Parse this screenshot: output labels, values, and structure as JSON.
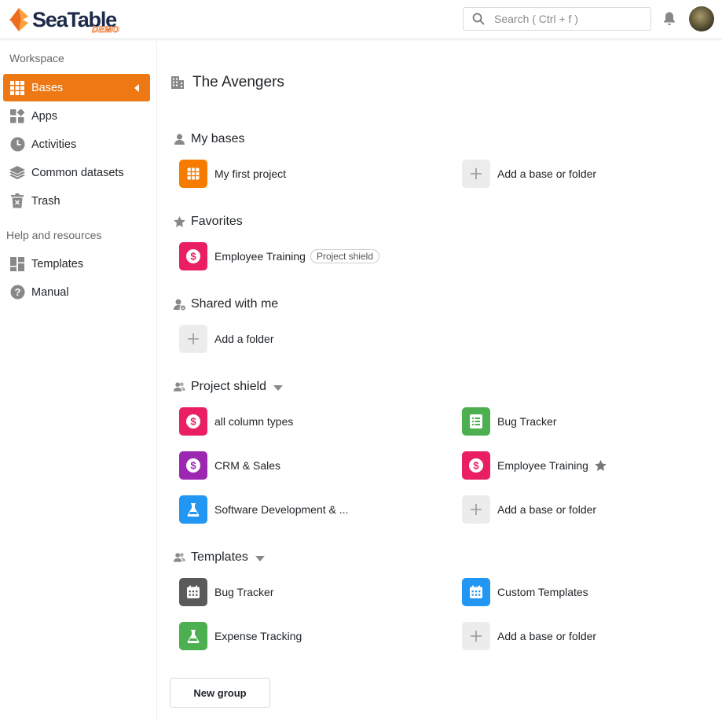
{
  "app": {
    "logo_text": "SeaTable",
    "logo_badge": "DEMO"
  },
  "search": {
    "placeholder": "Search ( Ctrl + f )"
  },
  "sidebar": {
    "workspace_header": "Workspace",
    "items": [
      {
        "label": "Bases",
        "icon": "grid-icon",
        "active": true
      },
      {
        "label": "Apps",
        "icon": "apps-icon"
      },
      {
        "label": "Activities",
        "icon": "clock-icon"
      },
      {
        "label": "Common datasets",
        "icon": "layers-icon"
      },
      {
        "label": "Trash",
        "icon": "trash-icon"
      }
    ],
    "help_header": "Help and resources",
    "help_items": [
      {
        "label": "Templates",
        "icon": "templates-icon"
      },
      {
        "label": "Manual",
        "icon": "question-icon"
      }
    ]
  },
  "main": {
    "workspace_title": "The Avengers",
    "sections": {
      "my_bases": {
        "title": "My bases",
        "tiles": [
          "My first project",
          "Add a base or folder"
        ]
      },
      "favorites": {
        "title": "Favorites",
        "tiles": [
          "Employee Training"
        ],
        "badge": "Project shield"
      },
      "shared": {
        "title": "Shared with me",
        "tiles": [
          "Add a folder"
        ]
      },
      "project_shield": {
        "title": "Project shield",
        "tiles": [
          "all column types",
          "Bug Tracker",
          "CRM & Sales",
          "Employee Training",
          "Software Development & ...",
          "Add a base or folder"
        ]
      },
      "templates": {
        "title": "Templates",
        "tiles": [
          "Bug Tracker",
          "Custom Templates",
          "Expense Tracking",
          "Add a base or folder"
        ]
      }
    },
    "new_group_label": "New group"
  },
  "colors": {
    "accent": "#ee7813",
    "orange": "#f57c00",
    "pink": "#e91e63",
    "green": "#4caf50",
    "purple": "#9c27b0",
    "blue": "#2196f3",
    "gray": "#5a5a5a"
  }
}
